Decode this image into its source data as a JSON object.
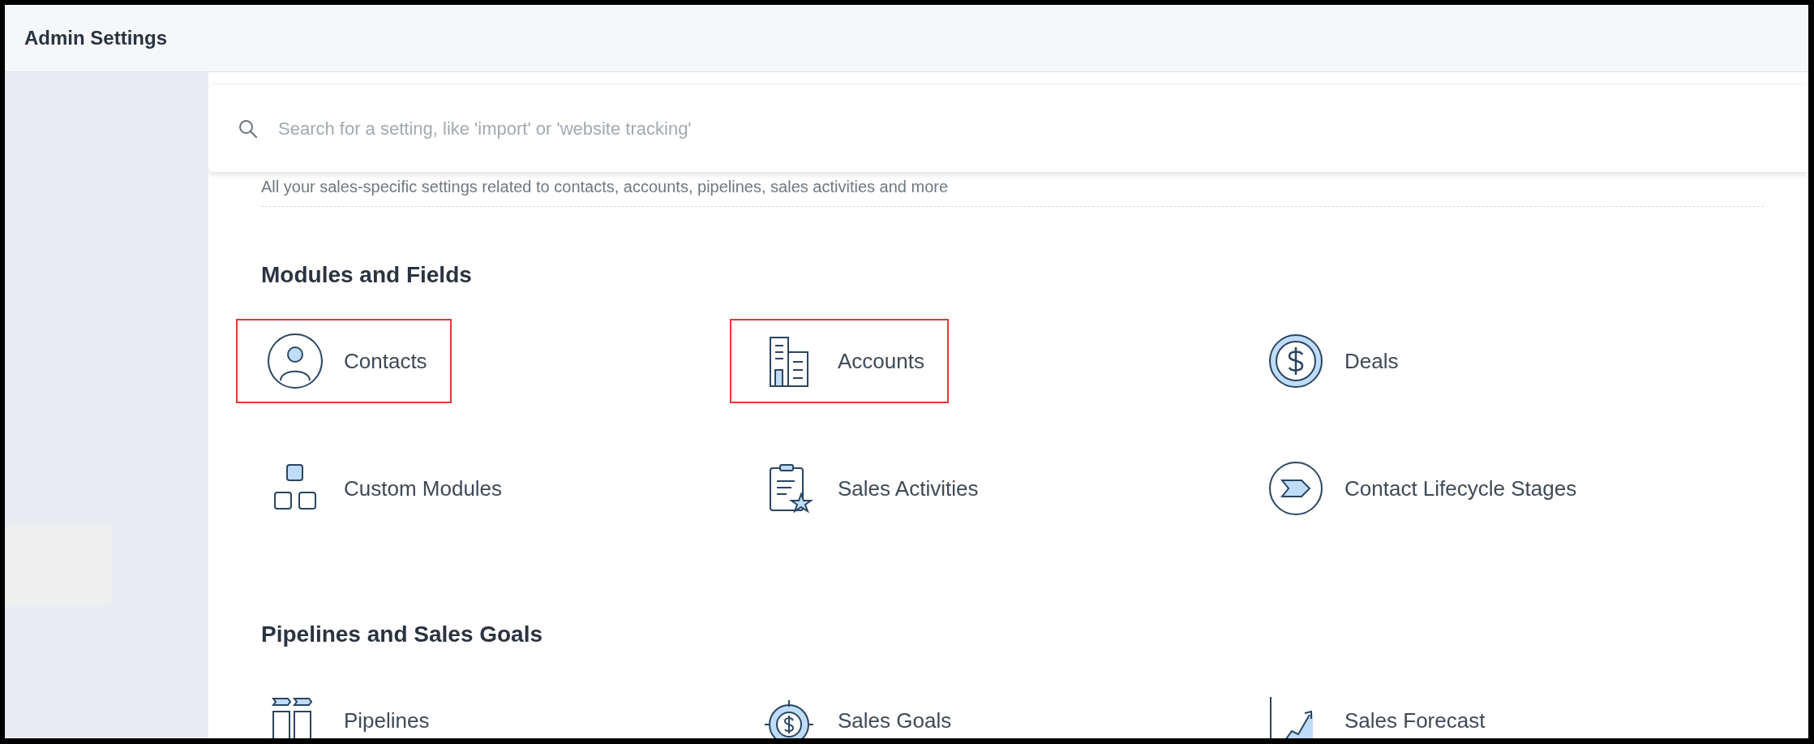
{
  "header": {
    "title": "Admin Settings"
  },
  "search": {
    "placeholder": "Search for a setting, like 'import' or 'website tracking'"
  },
  "subtitle": "All your sales-specific settings related to contacts, accounts, pipelines, sales activities and more",
  "sections": [
    {
      "title": "Modules and Fields",
      "items": [
        {
          "label": "Contacts",
          "kind": "contacts",
          "highlighted": true
        },
        {
          "label": "Accounts",
          "kind": "accounts",
          "highlighted": true
        },
        {
          "label": "Deals",
          "kind": "deals",
          "highlighted": false
        },
        {
          "label": "Custom Modules",
          "kind": "modules",
          "highlighted": false
        },
        {
          "label": "Sales Activities",
          "kind": "activities",
          "highlighted": false
        },
        {
          "label": "Contact Lifecycle Stages",
          "kind": "lifecycle",
          "highlighted": false
        }
      ]
    },
    {
      "title": "Pipelines and Sales Goals",
      "items": [
        {
          "label": "Pipelines",
          "kind": "pipelines",
          "highlighted": false
        },
        {
          "label": "Sales Goals",
          "kind": "goals",
          "highlighted": false
        },
        {
          "label": "Sales Forecast",
          "kind": "forecast",
          "highlighted": false
        }
      ]
    }
  ]
}
